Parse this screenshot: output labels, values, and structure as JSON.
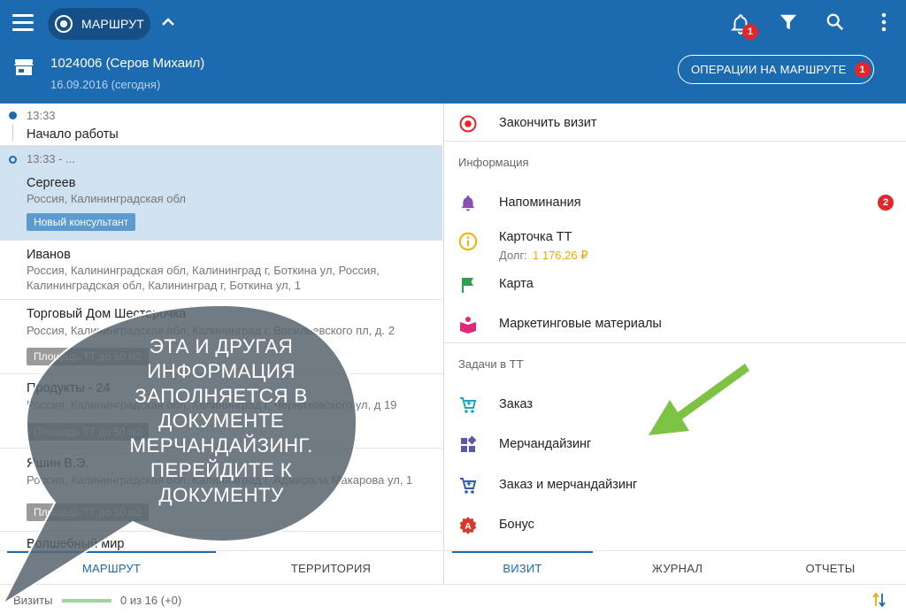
{
  "header": {
    "route_label": "МАРШРУТ",
    "notifications_count": "1",
    "client_name": "1024006 (Серов Михаил)",
    "date": "16.09.2016 (сегодня)",
    "ops_button_label": "ОПЕРАЦИИ НА МАРШРУТЕ",
    "ops_count": "1",
    "colors": {
      "primary": "#1c6ab0",
      "badge": "#e2262a"
    }
  },
  "route": {
    "items": [
      {
        "time": "13:33",
        "name": "Начало работы"
      },
      {
        "time": "13:33 - ...",
        "name": "Сергеев",
        "address": "Россия, Калининградская обл",
        "tag": "Новый консультант"
      },
      {
        "name": "Иванов",
        "address": "Россия, Калининградская обл, Калининград г, Боткина ул, Россия, Калининградская обл, Калининград г, Боткина ул, 1"
      },
      {
        "name": "Торговый Дом Шестерочка",
        "address": "Россия, Калининградская обл, Калининград г, Васильевского пл, д. 2",
        "tag": "Площадь ТТ до 50 м2"
      },
      {
        "name": "Продукты - 24",
        "address": "Россия, Калининградская обл, Калининград г, Черняховского ул, д 19",
        "tag": "Площадь ТТ до 50 м2"
      },
      {
        "name": "Яшин В.Э.",
        "address": "Россия, Калининградская обл, Калининград г, Адмирала Макарова ул, 1",
        "tag": "Площадь ТТ до 50 м2"
      },
      {
        "name": "Волшебный мир"
      }
    ]
  },
  "visit": {
    "end_visit": "Закончить визит",
    "info_section": "Информация",
    "reminders": "Напоминания",
    "reminders_count": "2",
    "card": "Карточка ТТ",
    "debt_label": "Долг:",
    "debt_value": "1 176,26 ₽",
    "map": "Карта",
    "marketing": "Маркетинговые материалы",
    "tasks_section": "Задачи в ТТ",
    "order": "Заказ",
    "merchandising": "Мерчандайзинг",
    "order_merch": "Заказ и мерчандайзинг",
    "bonus": "Бонус"
  },
  "tabs_left": [
    {
      "label": "МАРШРУТ",
      "active": true
    },
    {
      "label": "ТЕРРИТОРИЯ",
      "active": false
    }
  ],
  "tabs_right": [
    {
      "label": "ВИЗИТ",
      "active": true
    },
    {
      "label": "ЖУРНАЛ",
      "active": false
    },
    {
      "label": "ОТЧЕТЫ",
      "active": false
    }
  ],
  "footer": {
    "visits_label": "Визиты",
    "visits_count": "0 из 16 (+0)",
    "visits_progress": 0
  },
  "overlay": {
    "callout_text": "Эта и другая информация заполняется в документе Мерчандайзинг. Перейдите к документу",
    "arrow_color": "#7dc242"
  },
  "icons": {
    "menu": "hamburger-icon",
    "route": "record-icon",
    "collapse": "chevron-up-icon",
    "notifications": "bell-icon",
    "filter": "filter-icon",
    "search": "search-icon",
    "more": "more-vert-icon",
    "store": "store-icon",
    "sort": "sort-icon"
  }
}
